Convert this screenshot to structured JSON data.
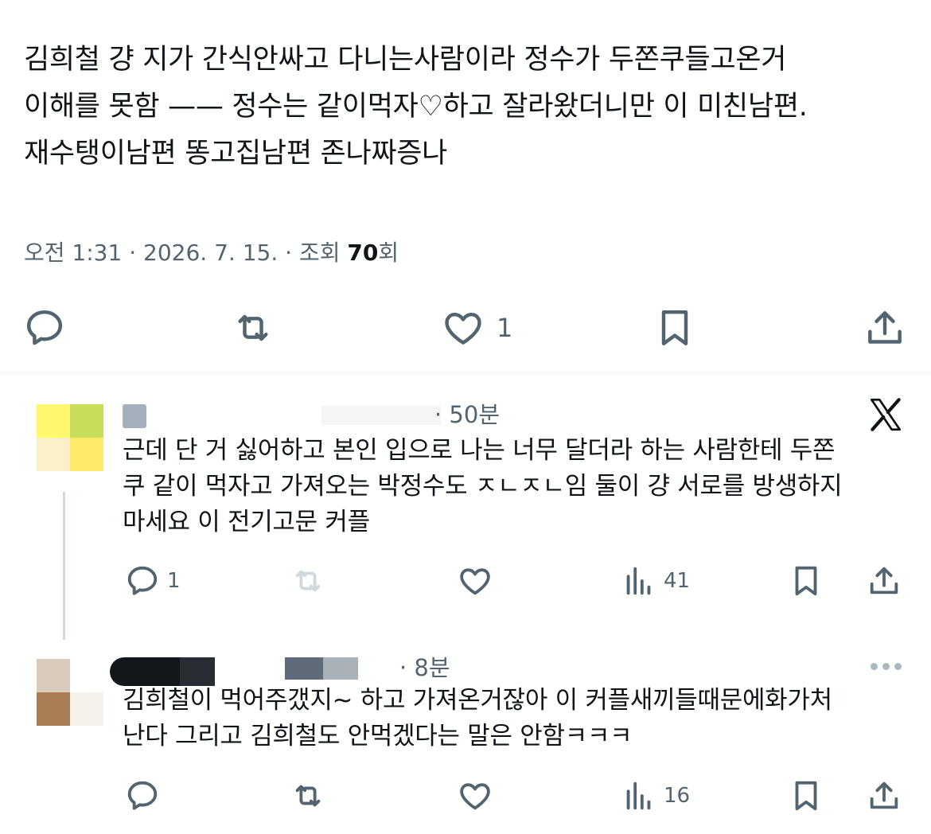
{
  "tweet": {
    "lines": [
      "김희철 걍 지가 간식안싸고 다니는사람이라 정수가 두쫀쿠들고온거",
      "이해를 못함 —— 정수는 같이먹자♡하고 잘라왔더니만 이 미친남편.",
      "재수탱이남편 똥고집남편 존나짜증나"
    ],
    "time": "오전 1:31",
    "date": "2026. 7. 15.",
    "views_label": "조회",
    "views_count": "70",
    "views_suffix": "회",
    "like_count": "1"
  },
  "icons": {
    "reply": "reply-bubble-icon",
    "retweet": "retweet-icon",
    "like": "heart-icon",
    "bookmark": "bookmark-icon",
    "share": "share-upload-icon",
    "views": "bar-chart-icon",
    "x_logo": "x-logo-icon",
    "more": "more-dots-icon"
  },
  "replies": [
    {
      "time": "· 50분",
      "lines": [
        "근데 단 거 싫어하고 본인 입으로 나는 너무 달더라 하는 사람한테 두쫀",
        "쿠 같이 먹자고 가져오는 박정수도 ㅈㄴㅈㄴ임 둘이 걍 서로를 방생하지",
        "마세요 이 전기고문 커플"
      ],
      "reply_count": "1",
      "views_count": "41"
    },
    {
      "time": "· 8분",
      "lines": [
        "김희철이 먹어주갰지~ 하고 가져온거잖아 이 커플새끼들때문에화가처",
        "난다 그리고 김희철도 안먹겠다는 말은 안함ㅋㅋㅋ"
      ],
      "reply_count": "",
      "views_count": "16"
    }
  ],
  "colors": {
    "text": "#0f1419",
    "secondary": "#536471",
    "divider": "#eff3f4",
    "avatar1": [
      "#fff86e",
      "#c9dd5c",
      "#fbf0c8",
      "#ffe96a"
    ],
    "avatar2": [
      "#d8cbbb",
      "#ffffff",
      "#a87c55",
      "#f6f1ea"
    ]
  }
}
